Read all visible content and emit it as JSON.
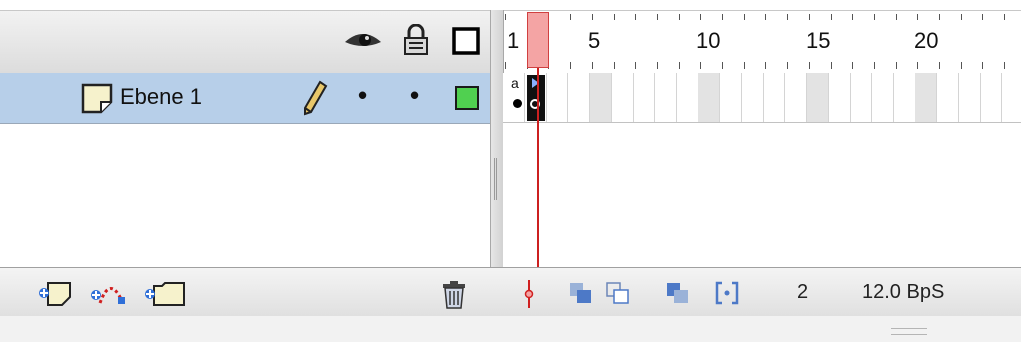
{
  "header": {
    "show_hide_icon": "eye-icon",
    "lock_icon": "lock-icon",
    "outline_icon": "outline-square-icon"
  },
  "ruler": {
    "frame_numbers": [
      "1",
      "5",
      "10",
      "15",
      "20"
    ],
    "current_frame_marker": "playhead"
  },
  "layers": [
    {
      "name": "Ebene 1",
      "icon": "layer-page-icon",
      "edit_icon": "pencil-icon",
      "visible_dot": "•",
      "lock_dot": "•",
      "outline_color": "#50d050",
      "selected": true,
      "keyframe_label": "a"
    }
  ],
  "bottom_bar": {
    "add_layer_icon": "add-layer-icon",
    "add_motion_guide_icon": "add-motion-guide-icon",
    "add_folder_icon": "add-folder-icon",
    "delete_icon": "trash-icon",
    "center_frame_icon": "center-frame-icon",
    "onion_skin_icon": "onion-skin-icon",
    "onion_outlines_icon": "onion-outlines-icon",
    "edit_multiple_icon": "edit-multiple-frames-icon",
    "modify_markers_icon": "modify-markers-icon",
    "current_frame": "2",
    "frame_rate": "12.0 BpS"
  },
  "colors": {
    "selected_row": "#b7cfe9",
    "playhead": "#cc2020",
    "playhead_fill": "#f4a4a4"
  }
}
